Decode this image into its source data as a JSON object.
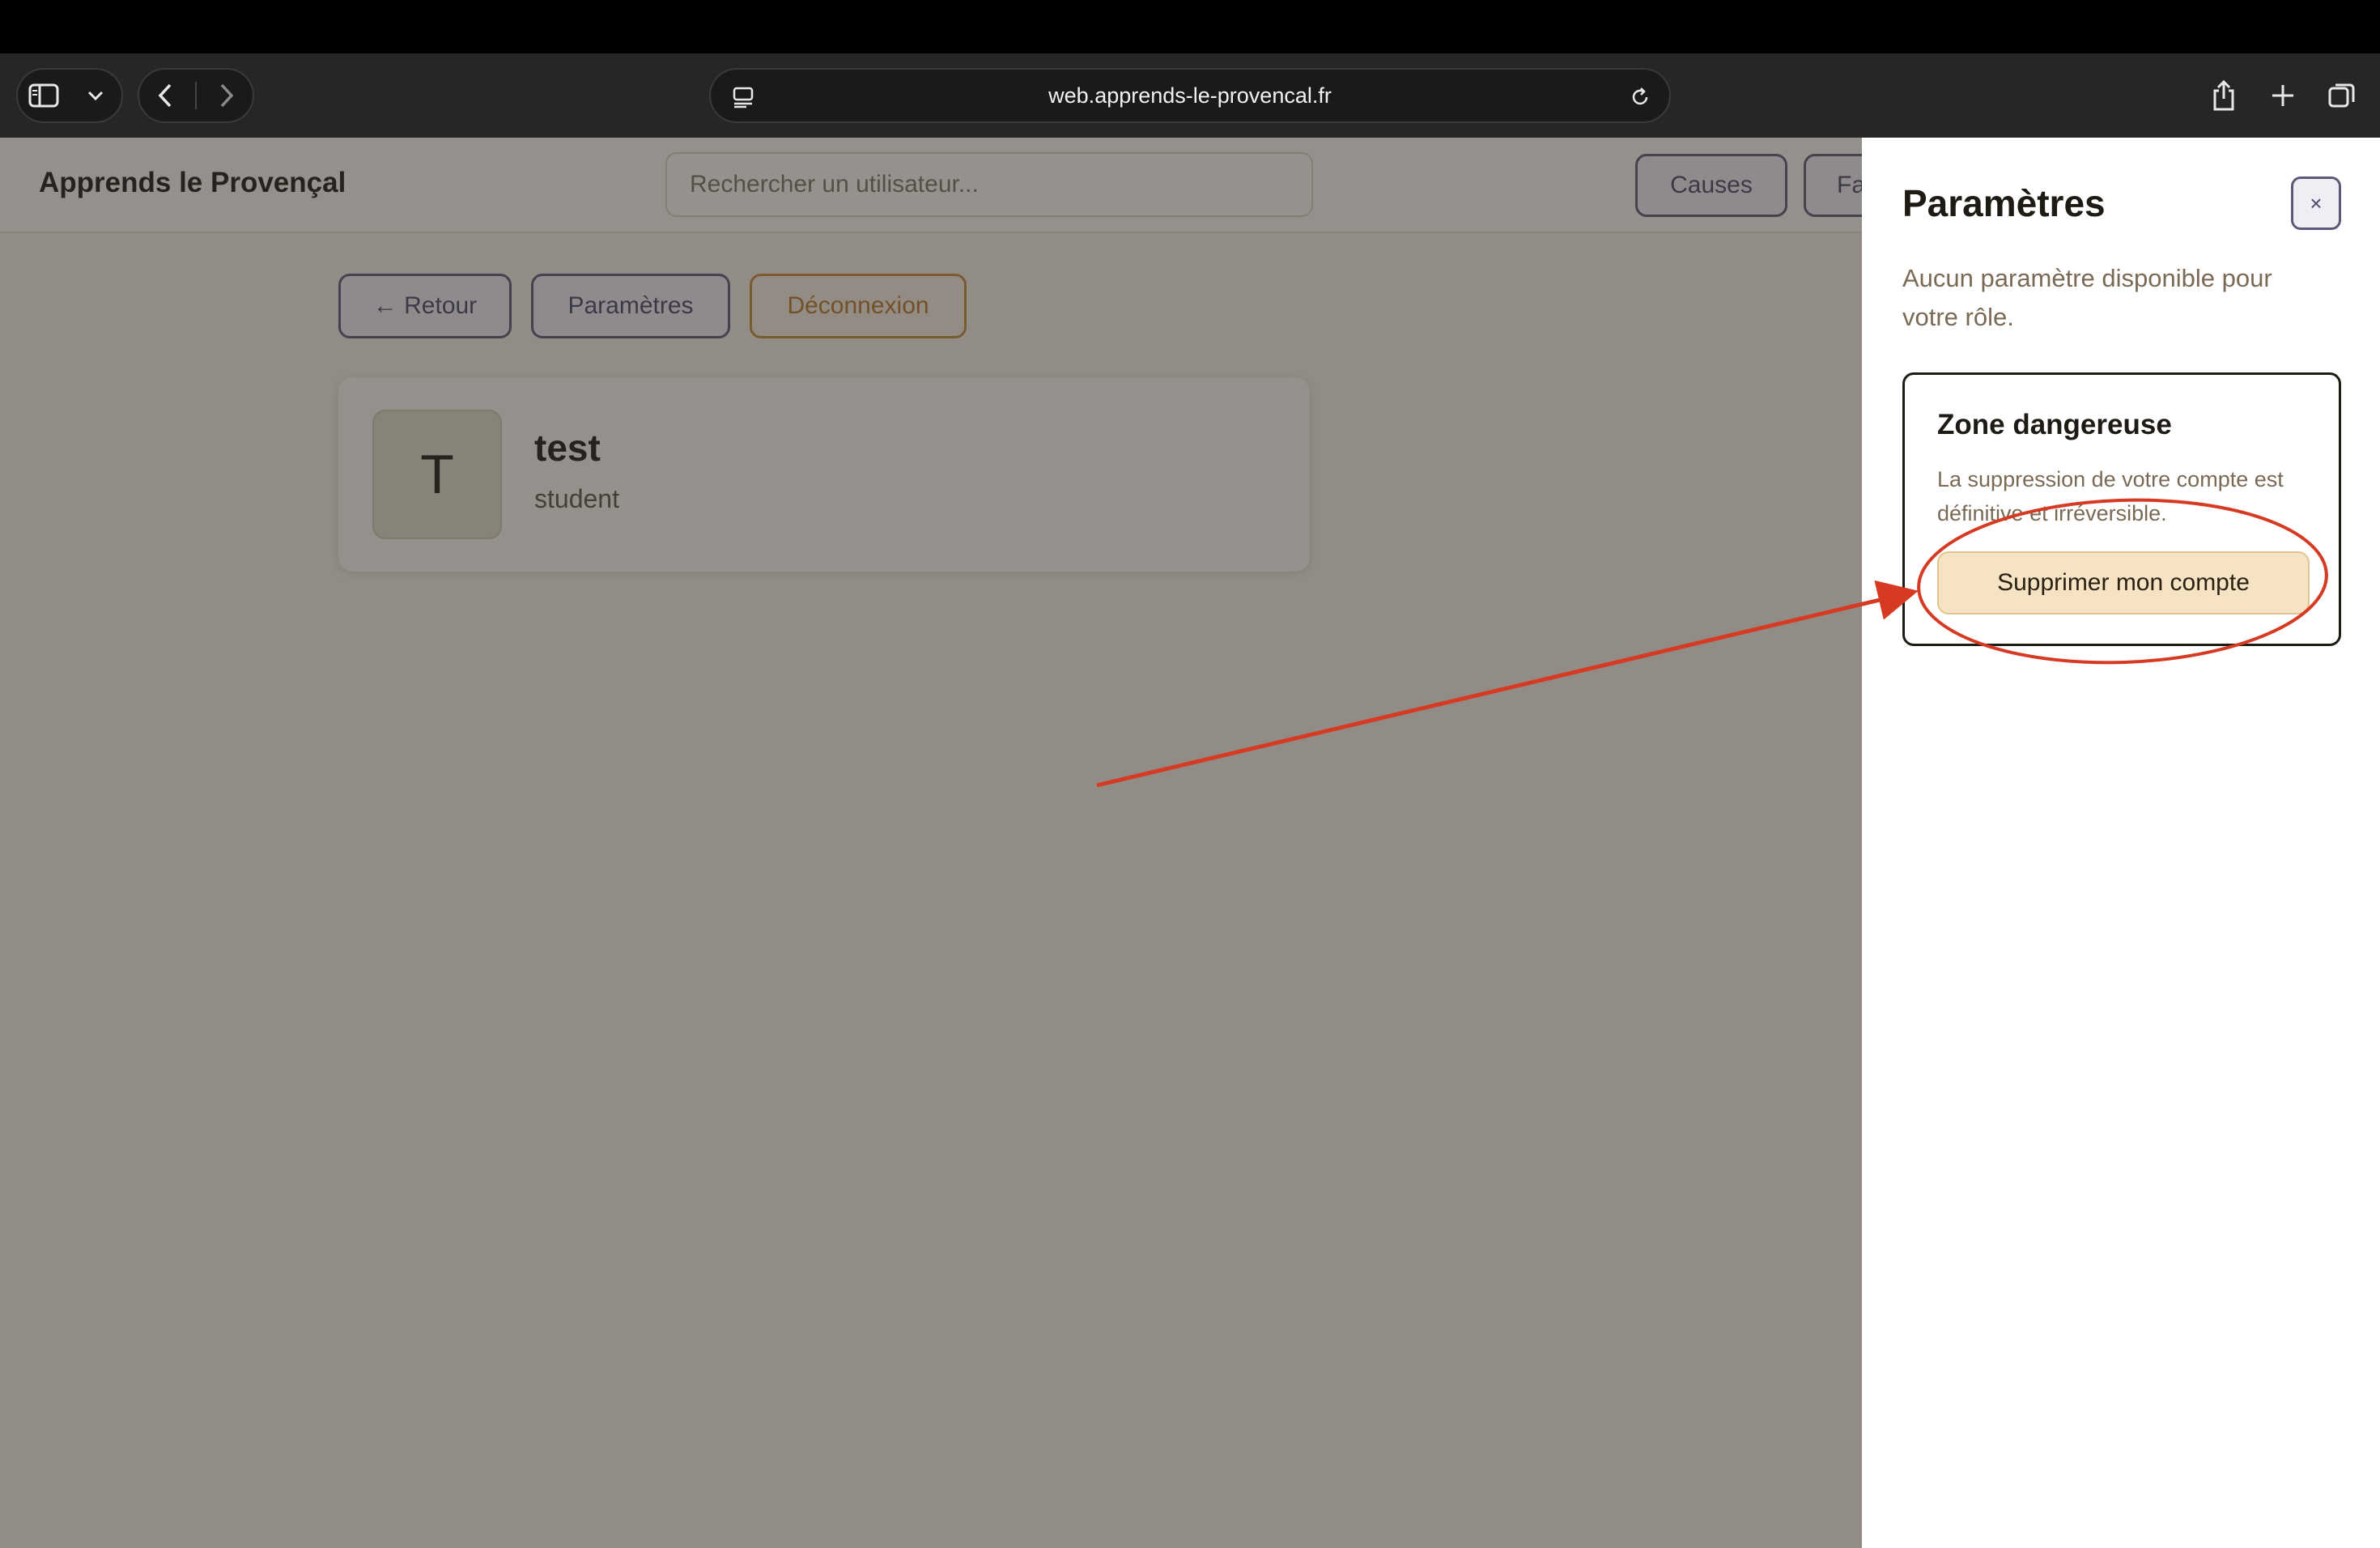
{
  "browser": {
    "url": "web.apprends-le-provencal.fr"
  },
  "app": {
    "title": "Apprends le Provençal",
    "search_placeholder": "Rechercher un utilisateur...",
    "header_buttons": [
      "Causes",
      "Fa"
    ]
  },
  "actions": {
    "back_label": "← Retour",
    "params_label": "Paramètres",
    "logout_label": "Déconnexion"
  },
  "profile": {
    "initial": "T",
    "name": "test",
    "role": "student"
  },
  "drawer": {
    "title": "Paramètres",
    "close_label": "×",
    "note": "Aucun paramètre disponible pour votre rôle.",
    "danger_zone": {
      "title": "Zone dangereuse",
      "text": "La suppression de votre compte est définitive et irréversible.",
      "button_label": "Supprimer mon compte"
    }
  },
  "colors": {
    "accent": "#5d5a78",
    "warning": "#c88a3a",
    "annotation": "#d63a22"
  }
}
